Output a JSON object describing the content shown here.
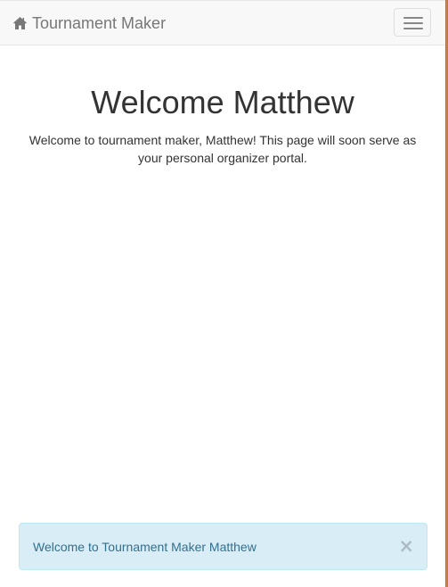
{
  "navbar": {
    "brand_label": "Tournament Maker",
    "brand_icon": "home-icon",
    "toggle_icon": "hamburger-menu-icon"
  },
  "main": {
    "heading": "Welcome Matthew",
    "lead": "Welcome to tournament maker, Matthew! This page will soon serve as your personal organizer portal."
  },
  "alert": {
    "message": "Welcome to Tournament Maker Matthew",
    "close_label": "×"
  },
  "colors": {
    "navbar_bg": "#f8f8f8",
    "brand_text": "#777777",
    "alert_bg": "#d9edf7",
    "alert_border": "#bce8f1",
    "alert_text": "#31708f"
  }
}
